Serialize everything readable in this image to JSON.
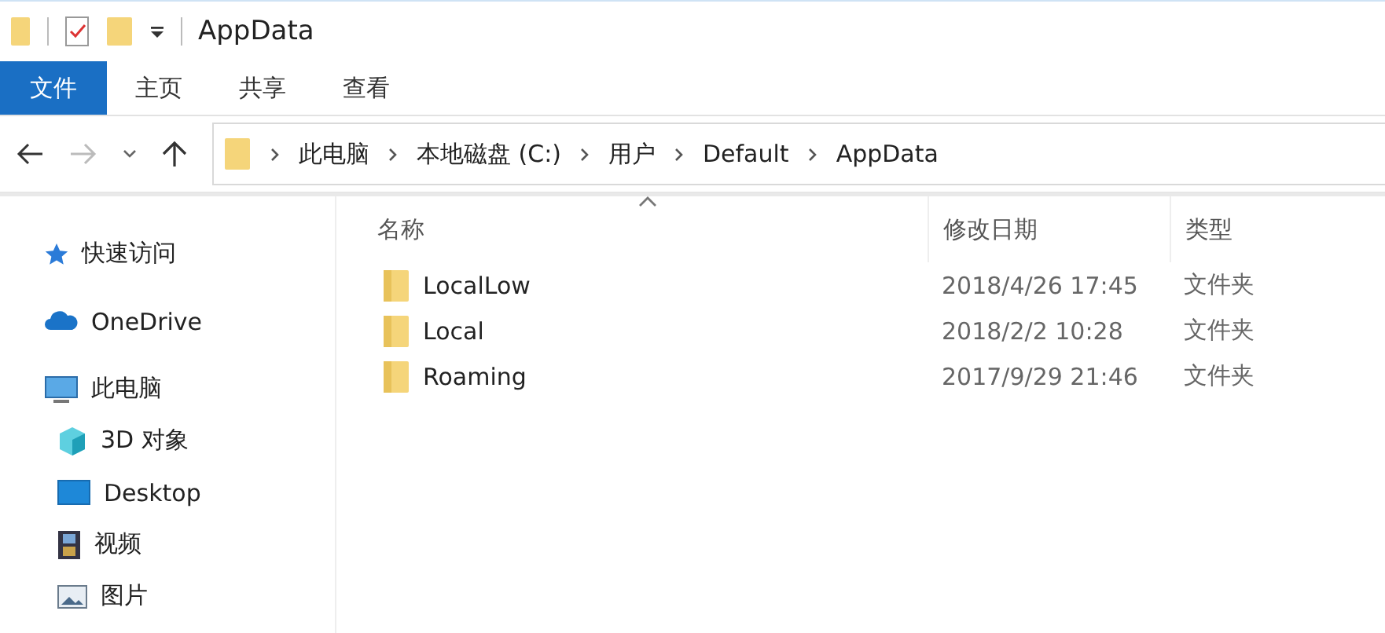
{
  "window": {
    "title": "AppData"
  },
  "tabs": [
    {
      "label": "文件",
      "selected": true
    },
    {
      "label": "主页",
      "selected": false
    },
    {
      "label": "共享",
      "selected": false
    },
    {
      "label": "查看",
      "selected": false
    }
  ],
  "address_bar": {
    "path": [
      "此电脑",
      "本地磁盘 (C:)",
      "用户",
      "Default",
      "AppData"
    ]
  },
  "sidebar": {
    "items": [
      {
        "label": "快速访问",
        "kind": "star"
      },
      {
        "label": "OneDrive",
        "kind": "cloud"
      },
      {
        "label": "此电脑",
        "kind": "monitor",
        "children": [
          {
            "label": "3D 对象",
            "kind": "cube"
          },
          {
            "label": "Desktop",
            "kind": "desktop"
          },
          {
            "label": "视频",
            "kind": "film"
          },
          {
            "label": "图片",
            "kind": "image"
          }
        ]
      }
    ]
  },
  "table": {
    "columns": [
      "名称",
      "修改日期",
      "类型"
    ],
    "rows": [
      {
        "name": "LocalLow",
        "modified": "2018/4/26 17:45",
        "type": "文件夹"
      },
      {
        "name": "Local",
        "modified": "2018/2/2 10:28",
        "type": "文件夹"
      },
      {
        "name": "Roaming",
        "modified": "2017/9/29 21:46",
        "type": "文件夹"
      }
    ]
  }
}
